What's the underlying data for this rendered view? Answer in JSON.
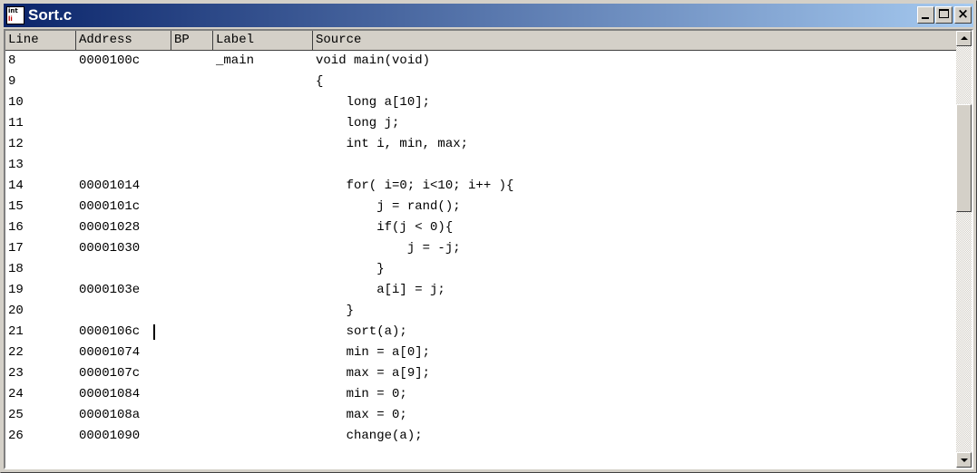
{
  "window": {
    "title": "Sort.c",
    "icon_name": "intl-app-icon",
    "icon_text_top": "int",
    "icon_text_bottom": "li"
  },
  "columns": [
    "Line",
    "Address",
    "BP",
    "Label",
    "Source"
  ],
  "rows": [
    {
      "line": "8",
      "address": "0000100c",
      "bp": "",
      "label": "_main",
      "source": "void main(void)"
    },
    {
      "line": "9",
      "address": "",
      "bp": "",
      "label": "",
      "source": "{"
    },
    {
      "line": "10",
      "address": "",
      "bp": "",
      "label": "",
      "source": "    long a[10];"
    },
    {
      "line": "11",
      "address": "",
      "bp": "",
      "label": "",
      "source": "    long j;"
    },
    {
      "line": "12",
      "address": "",
      "bp": "",
      "label": "",
      "source": "    int i, min, max;"
    },
    {
      "line": "13",
      "address": "",
      "bp": "",
      "label": "",
      "source": ""
    },
    {
      "line": "14",
      "address": "00001014",
      "bp": "",
      "label": "",
      "source": "    for( i=0; i<10; i++ ){"
    },
    {
      "line": "15",
      "address": "0000101c",
      "bp": "",
      "label": "",
      "source": "        j = rand();"
    },
    {
      "line": "16",
      "address": "00001028",
      "bp": "",
      "label": "",
      "source": "        if(j < 0){"
    },
    {
      "line": "17",
      "address": "00001030",
      "bp": "",
      "label": "",
      "source": "            j = -j;"
    },
    {
      "line": "18",
      "address": "",
      "bp": "",
      "label": "",
      "source": "        }"
    },
    {
      "line": "19",
      "address": "0000103e",
      "bp": "",
      "label": "",
      "source": "        a[i] = j;"
    },
    {
      "line": "20",
      "address": "",
      "bp": "",
      "label": "",
      "source": "    }"
    },
    {
      "line": "21",
      "address": "0000106c",
      "bp": "",
      "label": "",
      "source": "    sort(a);"
    },
    {
      "line": "22",
      "address": "00001074",
      "bp": "",
      "label": "",
      "source": "    min = a[0];"
    },
    {
      "line": "23",
      "address": "0000107c",
      "bp": "",
      "label": "",
      "source": "    max = a[9];"
    },
    {
      "line": "24",
      "address": "00001084",
      "bp": "",
      "label": "",
      "source": "    min = 0;"
    },
    {
      "line": "25",
      "address": "0000108a",
      "bp": "",
      "label": "",
      "source": "    max = 0;"
    },
    {
      "line": "26",
      "address": "00001090",
      "bp": "",
      "label": "",
      "source": "    change(a);"
    }
  ],
  "caret_row": "21",
  "scrollbar": {
    "icons": [
      "scroll-up-arrow-icon",
      "scroll-down-arrow-icon"
    ]
  },
  "colors": {
    "titlebar_start": "#0a246a",
    "titlebar_end": "#a6caf0",
    "face": "#d4d0c8"
  }
}
